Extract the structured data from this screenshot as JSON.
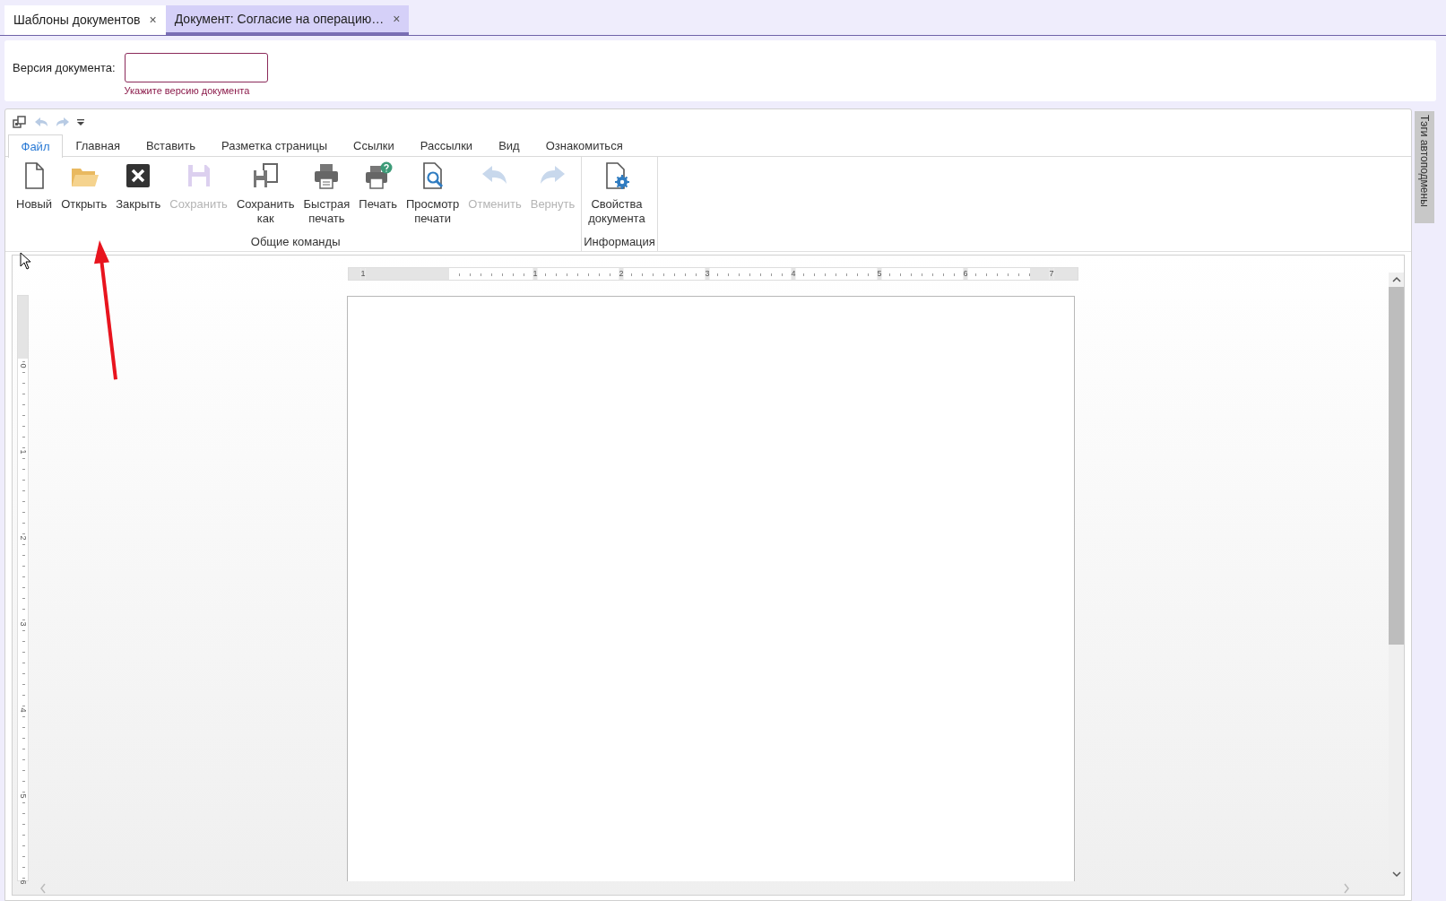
{
  "tabs": [
    {
      "label": "Шаблоны документов",
      "close": "×",
      "selected": false
    },
    {
      "label": "Документ: Согласие на операцию…",
      "close": "×",
      "selected": true
    }
  ],
  "version": {
    "label": "Версия документа:",
    "error": "Укажите версию документа",
    "invalid": true
  },
  "ribbon": {
    "tabs": [
      {
        "label": "Файл",
        "selected": true
      },
      {
        "label": "Главная",
        "selected": false
      },
      {
        "label": "Вставить",
        "selected": false
      },
      {
        "label": "Разметка страницы",
        "selected": false
      },
      {
        "label": "Ссылки",
        "selected": false
      },
      {
        "label": "Рассылки",
        "selected": false
      },
      {
        "label": "Вид",
        "selected": false
      },
      {
        "label": "Ознакомиться",
        "selected": false
      }
    ],
    "groups": [
      {
        "label": "Общие команды",
        "buttons": [
          {
            "kind": "new",
            "label": "Новый",
            "disabled": false
          },
          {
            "kind": "open",
            "label": "Открыть",
            "disabled": false
          },
          {
            "kind": "close",
            "label": "Закрыть",
            "disabled": false
          },
          {
            "kind": "save",
            "label": "Сохранить",
            "disabled": true
          },
          {
            "kind": "save_as",
            "label": "Сохранить\nкак",
            "disabled": false
          },
          {
            "kind": "quick_print",
            "label": "Быстрая\nпечать",
            "disabled": false
          },
          {
            "kind": "print",
            "label": "Печать",
            "disabled": false
          },
          {
            "kind": "preview",
            "label": "Просмотр\nпечати",
            "disabled": false
          },
          {
            "kind": "undo",
            "label": "Отменить",
            "disabled": true
          },
          {
            "kind": "redo",
            "label": "Вернуть",
            "disabled": true
          }
        ]
      },
      {
        "label": "Информация",
        "buttons": [
          {
            "kind": "properties",
            "label": "Свойства\nдокумента",
            "disabled": false
          }
        ]
      }
    ]
  },
  "horizontal_ruler": {
    "labels": [
      "1",
      "1",
      "2",
      "3",
      "4",
      "5",
      "6",
      "7"
    ]
  },
  "vertical_ruler": {
    "labels": [
      "0",
      "1",
      "2",
      "3",
      "4",
      "5",
      "6"
    ]
  },
  "side_panel": {
    "label": "Тэги автоподмены"
  }
}
